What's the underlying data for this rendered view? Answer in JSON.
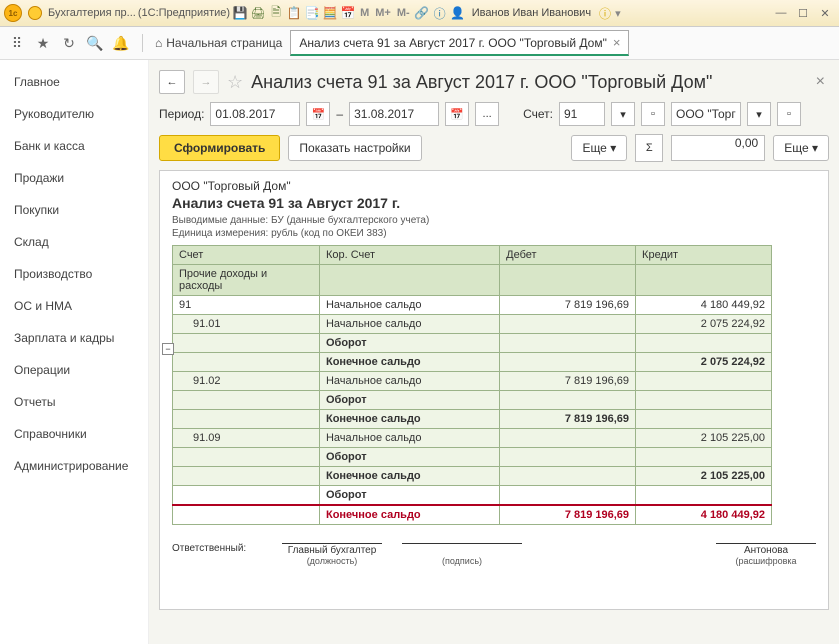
{
  "titlebar": {
    "app_title": "Бухгалтерия пр...",
    "platform": "(1С:Предприятие)",
    "user": "Иванов Иван Иванович"
  },
  "toolbar": {
    "home": "Начальная страница",
    "tab": "Анализ счета 91 за Август 2017 г. ООО \"Торговый Дом\""
  },
  "sidebar": {
    "items": [
      "Главное",
      "Руководителю",
      "Банк и касса",
      "Продажи",
      "Покупки",
      "Склад",
      "Производство",
      "ОС и НМА",
      "Зарплата и кадры",
      "Операции",
      "Отчеты",
      "Справочники",
      "Администрирование"
    ]
  },
  "page": {
    "title": "Анализ счета 91 за Август 2017 г. ООО \"Торговый Дом\""
  },
  "filters": {
    "period_label": "Период:",
    "date_from": "01.08.2017",
    "date_to": "31.08.2017",
    "dash": "–",
    "dots": "...",
    "account_label": "Счет:",
    "account": "91",
    "org": "ООО \"Торг"
  },
  "actions": {
    "form": "Сформировать",
    "settings": "Показать настройки",
    "more": "Еще",
    "value": "0,00"
  },
  "report": {
    "company": "ООО \"Торговый Дом\"",
    "title": "Анализ счета 91 за Август 2017 г.",
    "meta1_label": "Выводимые данные:",
    "meta1_val": "БУ (данные бухгалтерского учета)",
    "meta2_label": "Единица измерения:",
    "meta2_val": "рубль (код по ОКЕИ 383)",
    "cols": {
      "c1": "Счет",
      "c1b": "Прочие доходы и расходы",
      "c2": "Кор. Счет",
      "c3": "Дебет",
      "c4": "Кредит"
    },
    "labels": {
      "open": "Начальное сальдо",
      "turn": "Оборот",
      "close": "Конечное сальдо"
    },
    "rows": [
      {
        "acct": "91",
        "label": "open",
        "debit": "7 819 196,69",
        "credit": "4 180 449,92"
      },
      {
        "acct": "91.01",
        "label": "open",
        "debit": "",
        "credit": "2 075 224,92",
        "sub": true
      },
      {
        "acct": "",
        "label": "turn",
        "bold": true,
        "sub": true
      },
      {
        "acct": "",
        "label": "close",
        "bold": true,
        "debit": "",
        "credit": "2 075 224,92",
        "sub": true
      },
      {
        "acct": "91.02",
        "label": "open",
        "debit": "7 819 196,69",
        "credit": "",
        "sub": true
      },
      {
        "acct": "",
        "label": "turn",
        "bold": true,
        "sub": true
      },
      {
        "acct": "",
        "label": "close",
        "bold": true,
        "debit": "7 819 196,69",
        "credit": "",
        "sub": true
      },
      {
        "acct": "91.09",
        "label": "open",
        "debit": "",
        "credit": "2 105 225,00",
        "sub": true
      },
      {
        "acct": "",
        "label": "turn",
        "bold": true,
        "sub": true
      },
      {
        "acct": "",
        "label": "close",
        "bold": true,
        "debit": "",
        "credit": "2 105 225,00",
        "sub": true
      },
      {
        "acct": "",
        "label": "turn",
        "bold": true
      },
      {
        "acct": "",
        "label": "close",
        "bold": true,
        "total": true,
        "debit": "7 819 196,69",
        "credit": "4 180 449,92"
      }
    ],
    "sig": {
      "resp": "Ответственный:",
      "chief": "Главный бухгалтер",
      "pos": "(должность)",
      "sign": "(подпись)",
      "name": "Антонова",
      "decode": "(расшифровка"
    }
  }
}
